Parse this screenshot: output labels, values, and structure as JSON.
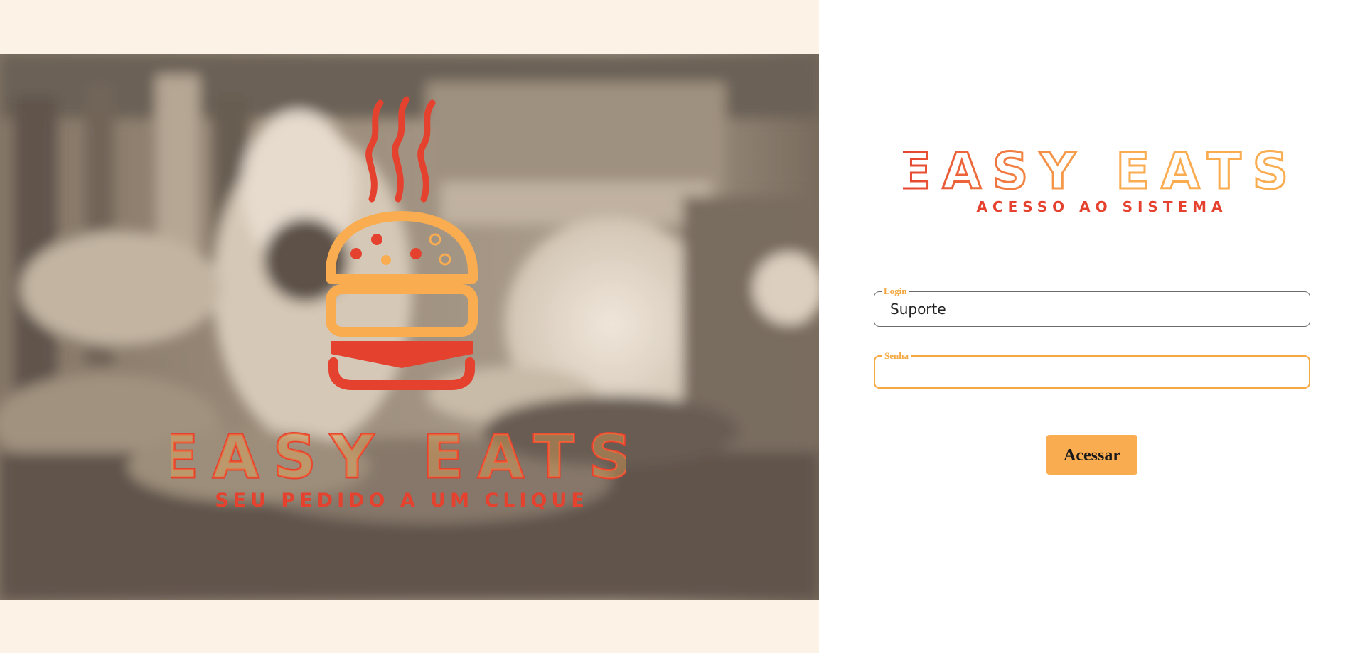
{
  "hero": {
    "brand_name": "EASY EATS",
    "tagline": "SEU PEDIDO A UM CLIQUE",
    "logo_icon": "burger-icon",
    "photo_subject": "chef-kitchen-photo"
  },
  "login_panel": {
    "brand_name": "EASY EATS",
    "subtitle": "ACESSO AO SISTEMA",
    "login_field": {
      "label": "Login",
      "value": "Suporte"
    },
    "password_field": {
      "label": "Senha",
      "value": ""
    },
    "submit_label": "Acessar"
  },
  "colors": {
    "red": "#e5412f",
    "orange": "#f9ac50",
    "panel_bg": "#fdf2e6",
    "focus_border": "#f5a742"
  }
}
